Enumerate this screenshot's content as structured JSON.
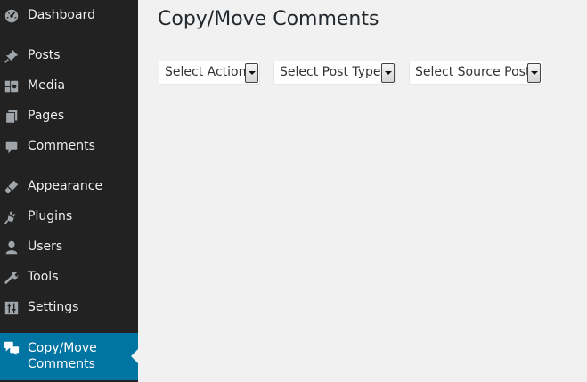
{
  "sidebar": {
    "items": [
      {
        "label": "Dashboard",
        "icon": "dashboard-icon"
      },
      {
        "label": "Posts",
        "icon": "pushpin-icon"
      },
      {
        "label": "Media",
        "icon": "media-icon"
      },
      {
        "label": "Pages",
        "icon": "pages-icon"
      },
      {
        "label": "Comments",
        "icon": "comment-icon"
      },
      {
        "label": "Appearance",
        "icon": "paintbrush-icon"
      },
      {
        "label": "Plugins",
        "icon": "plugin-icon"
      },
      {
        "label": "Users",
        "icon": "user-icon"
      },
      {
        "label": "Tools",
        "icon": "wrench-icon"
      },
      {
        "label": "Settings",
        "icon": "settings-icon"
      },
      {
        "label": "Copy/Move Comments",
        "icon": "comments-icon",
        "active": true
      }
    ]
  },
  "main": {
    "title": "Copy/Move Comments",
    "selects": [
      {
        "selected": "Select Action"
      },
      {
        "selected": "Select Post Type"
      },
      {
        "selected": "Select Source Post"
      }
    ]
  },
  "colors": {
    "sidebar_bg": "#222222",
    "active_bg": "#0074a2",
    "page_bg": "#f1f1f1"
  }
}
